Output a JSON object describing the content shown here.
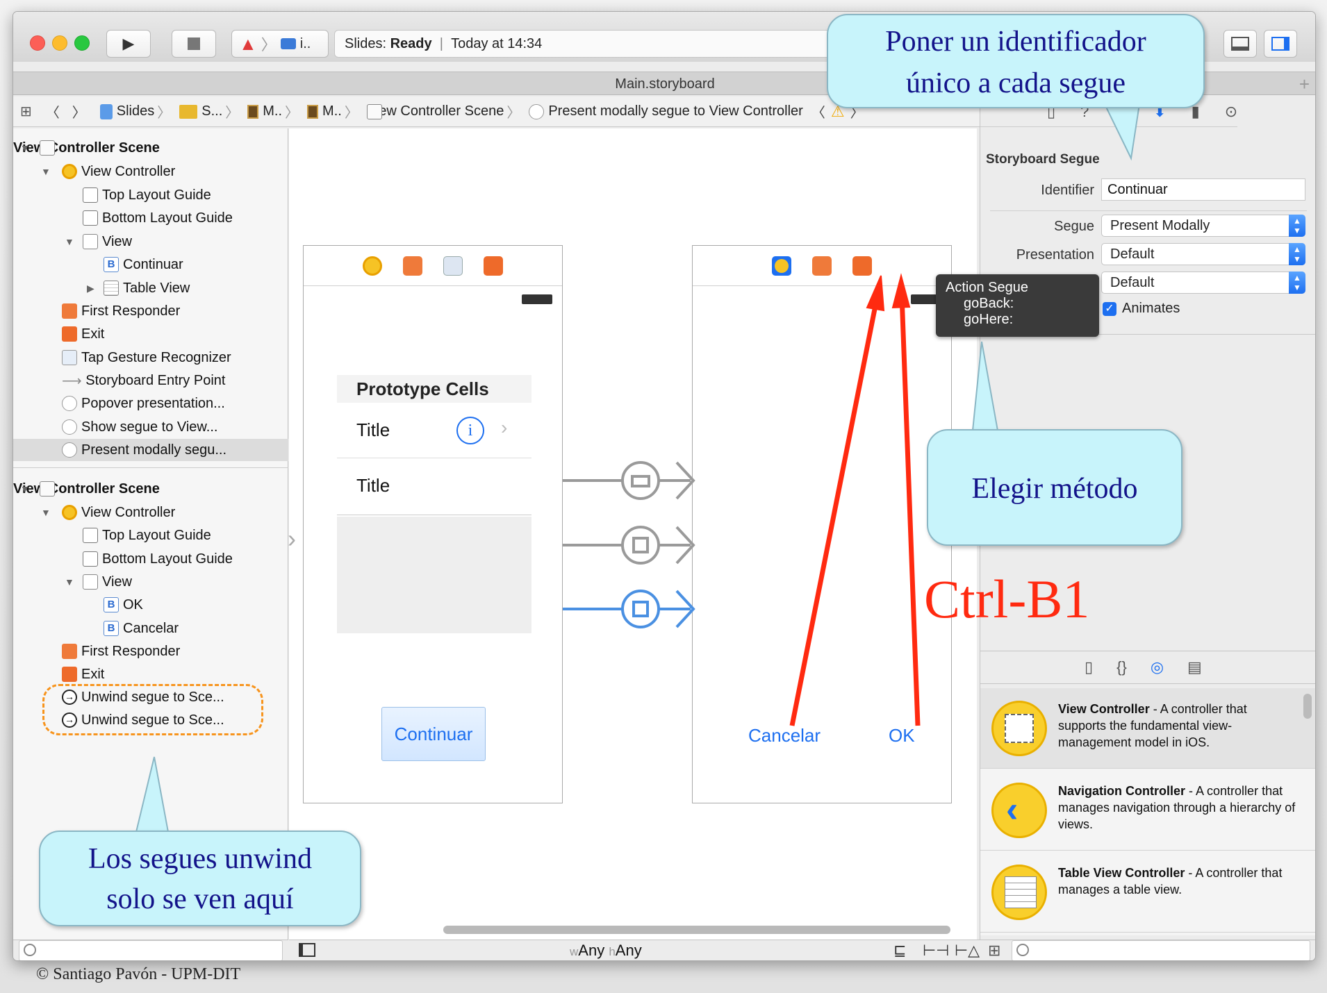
{
  "toolbar": {
    "scheme_short": "i..",
    "activity": {
      "app": "Slides:",
      "status": "Ready",
      "separator": "|",
      "time": "Today at 14:34"
    }
  },
  "tab": {
    "title": "Main.storyboard"
  },
  "jumpbar": {
    "items": [
      "Slides",
      "S...",
      "M..",
      "M..",
      "View Controller Scene",
      "Present modally segue to View Controller"
    ]
  },
  "outline": {
    "scene1": {
      "title": "View Controller Scene",
      "items": [
        "View Controller",
        "Top Layout Guide",
        "Bottom Layout Guide",
        "View",
        "Continuar",
        "Table View",
        "First Responder",
        "Exit",
        "Tap Gesture Recognizer",
        "Storyboard Entry Point",
        "Popover presentation...",
        "Show segue to View...",
        "Present modally segu..."
      ]
    },
    "scene2": {
      "title": "View Controller Scene",
      "items": [
        "View Controller",
        "Top Layout Guide",
        "Bottom Layout Guide",
        "View",
        "OK",
        "Cancelar",
        "First Responder",
        "Exit",
        "Unwind segue to Sce...",
        "Unwind segue to Sce..."
      ]
    }
  },
  "canvas": {
    "scene_left": {
      "section_header": "Prototype Cells",
      "cell1": "Title",
      "cell2": "Title",
      "button": "Continuar"
    },
    "scene_right": {
      "cancel": "Cancelar",
      "ok": "OK"
    },
    "size_class": {
      "w": "w",
      "w_value": "Any",
      "h": "h",
      "h_value": "Any"
    },
    "tooltip": {
      "title": "Action Segue",
      "items": [
        "goBack:",
        "goHere:"
      ]
    }
  },
  "inspector": {
    "section_title": "Storyboard Segue",
    "identifier_label": "Identifier",
    "identifier_value": "Continuar",
    "segue_label": "Segue",
    "segue_value": "Present Modally",
    "presentation_label": "Presentation",
    "presentation_value": "Default",
    "transition_value": "Default",
    "animates_label": "Animates"
  },
  "library": [
    {
      "name": "View Controller",
      "desc": " - A controller that supports the fundamental view-management model in iOS."
    },
    {
      "name": "Navigation Controller",
      "desc": " - A controller that manages navigation through a hierarchy of views."
    },
    {
      "name": "Table View Controller",
      "desc": " - A controller that manages a table view."
    }
  ],
  "annotations": {
    "callout_identifier": [
      "Poner un identificador",
      "único a cada segue"
    ],
    "callout_method": "Elegir método",
    "callout_unwind": [
      "Los segues unwind",
      "solo se ven aquí"
    ],
    "ctrl_label": "Ctrl-B1",
    "footer": "© Santiago Pavón - UPM-DIT"
  },
  "colors": {
    "accent": "#1d6ff0",
    "annotation_red": "#ff2a10",
    "highlight_orange": "#f7941d",
    "callout_fill": "#c8f4fb"
  }
}
